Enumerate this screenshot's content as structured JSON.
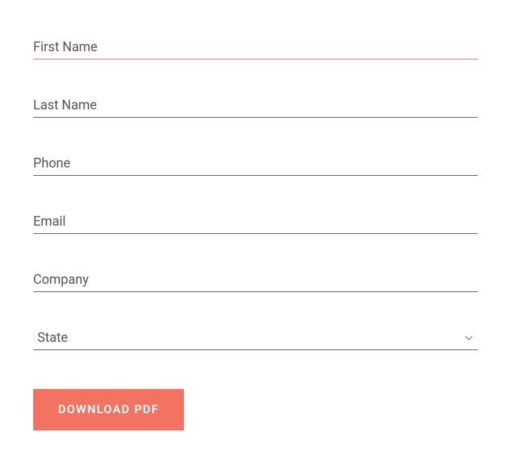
{
  "form": {
    "fields": {
      "first_name": {
        "placeholder": "First Name",
        "value": ""
      },
      "last_name": {
        "placeholder": "Last Name",
        "value": ""
      },
      "phone": {
        "placeholder": "Phone",
        "value": ""
      },
      "email": {
        "placeholder": "Email",
        "value": ""
      },
      "company": {
        "placeholder": "Company",
        "value": ""
      },
      "state": {
        "selected_label": "State"
      }
    },
    "submit_label": "DOWNLOAD PDF"
  },
  "colors": {
    "accent": "#f37362",
    "text": "#555"
  }
}
